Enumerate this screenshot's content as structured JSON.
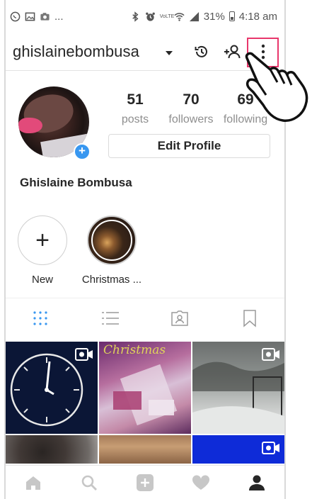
{
  "status_bar": {
    "dots": "...",
    "battery_percent": "31%",
    "time": "4:18 am",
    "network_label": "VoLTE"
  },
  "header": {
    "username": "ghislainebombusa",
    "icons": [
      "dropdown-caret-icon",
      "archive-history-icon",
      "discover-people-icon",
      "more-options-icon"
    ]
  },
  "profile": {
    "stats": [
      {
        "value": "51",
        "label": "posts"
      },
      {
        "value": "70",
        "label": "followers"
      },
      {
        "value": "69",
        "label": "following"
      }
    ],
    "edit_button": "Edit Profile",
    "full_name": "Ghislaine Bombusa"
  },
  "highlights": [
    {
      "label": "New",
      "type": "new"
    },
    {
      "label": "Christmas ...",
      "type": "story"
    }
  ],
  "grid": {
    "xmas_caption": "Christmas"
  },
  "tabs": [
    "grid-view-icon",
    "list-view-icon",
    "tagged-icon",
    "saved-icon"
  ],
  "colors": {
    "accent_blue": "#3897f0",
    "highlight_box": "#e8366b",
    "text": "#262626",
    "muted": "#8e8e8e"
  }
}
